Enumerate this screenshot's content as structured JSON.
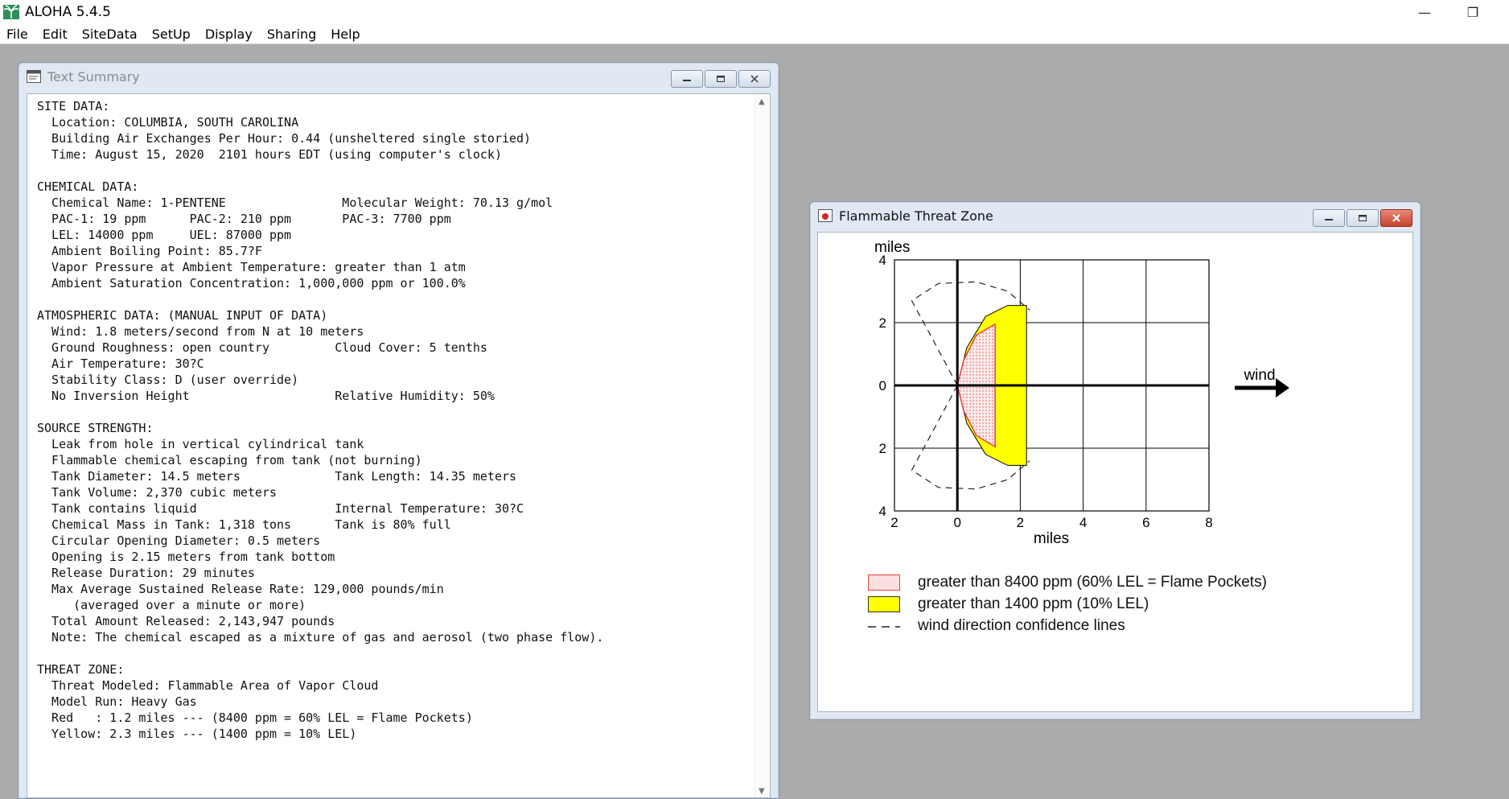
{
  "app": {
    "title": "ALOHA 5.4.5",
    "minimize_glyph": "—",
    "restore_glyph": "❐"
  },
  "menu": [
    "File",
    "Edit",
    "SiteData",
    "SetUp",
    "Display",
    "Sharing",
    "Help"
  ],
  "text_summary": {
    "title": "Text Summary",
    "lines": [
      "SITE DATA:",
      "  Location: COLUMBIA, SOUTH CAROLINA",
      "  Building Air Exchanges Per Hour: 0.44 (unsheltered single storied)",
      "  Time: August 15, 2020  2101 hours EDT (using computer's clock)",
      "",
      "CHEMICAL DATA:",
      "  Chemical Name: 1-PENTENE                Molecular Weight: 70.13 g/mol",
      "  PAC-1: 19 ppm      PAC-2: 210 ppm       PAC-3: 7700 ppm",
      "  LEL: 14000 ppm     UEL: 87000 ppm",
      "  Ambient Boiling Point: 85.7?F",
      "  Vapor Pressure at Ambient Temperature: greater than 1 atm",
      "  Ambient Saturation Concentration: 1,000,000 ppm or 100.0%",
      "",
      "ATMOSPHERIC DATA: (MANUAL INPUT OF DATA)",
      "  Wind: 1.8 meters/second from N at 10 meters",
      "  Ground Roughness: open country         Cloud Cover: 5 tenths",
      "  Air Temperature: 30?C",
      "  Stability Class: D (user override)",
      "  No Inversion Height                    Relative Humidity: 50%",
      "",
      "SOURCE STRENGTH:",
      "  Leak from hole in vertical cylindrical tank",
      "  Flammable chemical escaping from tank (not burning)",
      "  Tank Diameter: 14.5 meters             Tank Length: 14.35 meters",
      "  Tank Volume: 2,370 cubic meters",
      "  Tank contains liquid                   Internal Temperature: 30?C",
      "  Chemical Mass in Tank: 1,318 tons      Tank is 80% full",
      "  Circular Opening Diameter: 0.5 meters",
      "  Opening is 2.15 meters from tank bottom",
      "  Release Duration: 29 minutes",
      "  Max Average Sustained Release Rate: 129,000 pounds/min",
      "     (averaged over a minute or more)",
      "  Total Amount Released: 2,143,947 pounds",
      "  Note: The chemical escaped as a mixture of gas and aerosol (two phase flow).",
      "",
      "THREAT ZONE:",
      "  Threat Modeled: Flammable Area of Vapor Cloud",
      "  Model Run: Heavy Gas",
      "  Red   : 1.2 miles --- (8400 ppm = 60% LEL = Flame Pockets)",
      "  Yellow: 2.3 miles --- (1400 ppm = 10% LEL)"
    ]
  },
  "threat_zone": {
    "title": "Flammable Threat Zone",
    "wind_label": "wind",
    "legend": [
      {
        "name": "red-zone",
        "label": "greater than 8400 ppm (60% LEL = Flame Pockets)",
        "fill": "#fbe0e0",
        "stroke": "#e3403c"
      },
      {
        "name": "yellow-zone",
        "label": "greater than 1400 ppm (10% LEL)",
        "fill": "#ffff00",
        "stroke": "#333333"
      },
      {
        "name": "confidence-lines",
        "label": "wind direction confidence lines"
      }
    ]
  },
  "chart_data": {
    "type": "area",
    "xlabel": "miles",
    "ylabel": "miles",
    "xlim": [
      -2,
      8
    ],
    "ylim": [
      -4,
      4
    ],
    "x_ticks": [
      2,
      0,
      2,
      4,
      6,
      8
    ],
    "y_ticks": [
      4,
      2,
      0,
      2,
      4
    ],
    "x_tick_values": [
      -2,
      0,
      2,
      4,
      6,
      8
    ],
    "y_tick_values": [
      4,
      2,
      0,
      -2,
      -4
    ],
    "grid": true,
    "colors": {
      "red": "#e3403c",
      "yellow": "#ffff00"
    },
    "zones": [
      {
        "name": "yellow",
        "boundary": [
          [
            0,
            0
          ],
          [
            0.3,
            1.2
          ],
          [
            0.9,
            2.2
          ],
          [
            1.6,
            2.55
          ],
          [
            2.2,
            2.55
          ],
          [
            2.2,
            -2.55
          ],
          [
            1.6,
            -2.55
          ],
          [
            0.9,
            -2.2
          ],
          [
            0.3,
            -1.2
          ]
        ]
      },
      {
        "name": "red",
        "boundary": [
          [
            0,
            0
          ],
          [
            0.2,
            0.8
          ],
          [
            0.6,
            1.6
          ],
          [
            1.2,
            1.95
          ],
          [
            1.2,
            -1.95
          ],
          [
            0.6,
            -1.6
          ],
          [
            0.2,
            -0.8
          ]
        ]
      }
    ],
    "confidence_lines": [
      [
        [
          0,
          0
        ],
        [
          -0.8,
          1.5
        ],
        [
          -1.45,
          2.7
        ],
        [
          -0.6,
          3.25
        ],
        [
          0.6,
          3.3
        ],
        [
          1.6,
          3.0
        ],
        [
          2.3,
          2.4
        ]
      ],
      [
        [
          0,
          0
        ],
        [
          -0.8,
          -1.5
        ],
        [
          -1.45,
          -2.7
        ],
        [
          -0.6,
          -3.25
        ],
        [
          0.6,
          -3.3
        ],
        [
          1.6,
          -3.0
        ],
        [
          2.3,
          -2.4
        ]
      ]
    ]
  }
}
